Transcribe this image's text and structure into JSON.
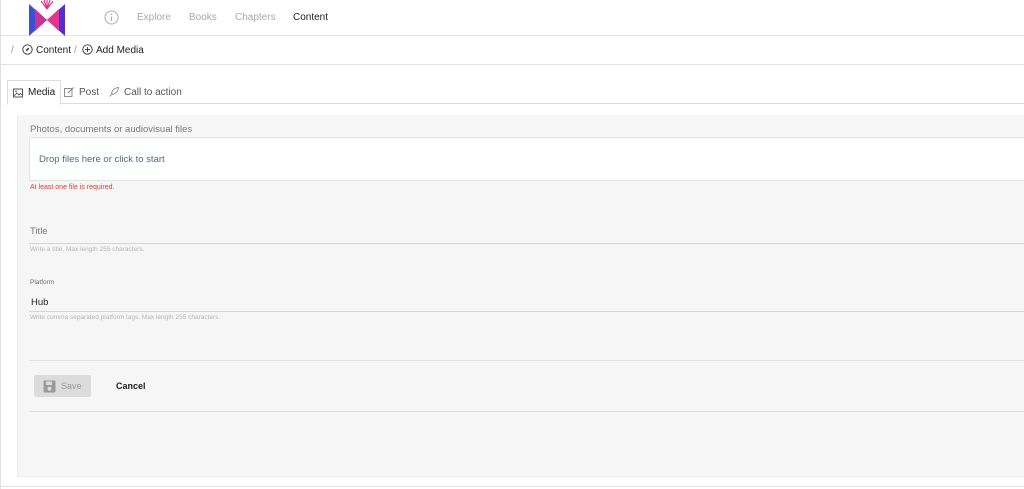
{
  "nav": {
    "items": [
      "Explore",
      "Books",
      "Chapters",
      "Content"
    ],
    "active": "Content"
  },
  "breadcrumb": {
    "separator": "/",
    "items": [
      "Content",
      "Add Media"
    ]
  },
  "tabs": [
    {
      "label": "Media",
      "icon": "image-icon"
    },
    {
      "label": "Post",
      "icon": "edit-icon"
    },
    {
      "label": "Call to action",
      "icon": "rocket-icon"
    }
  ],
  "form": {
    "files_label": "Photos, documents or audiovisual files",
    "dropzone_text": "Drop files here or click to start",
    "files_error": "At least one file is required.",
    "title_placeholder": "Title",
    "title_help": "Write a title. Max length 255 characters.",
    "platform_label": "Platform",
    "platform_value": "Hub",
    "platform_help": "Write comma separated platform tags. Max length 255 characters.",
    "save_label": "Save",
    "cancel_label": "Cancel"
  },
  "colors": {
    "logo_blue": "#3b4fd8",
    "logo_pink": "#e0368f",
    "error_red": "#e03a2a",
    "link_blue": "#4a6c84"
  }
}
